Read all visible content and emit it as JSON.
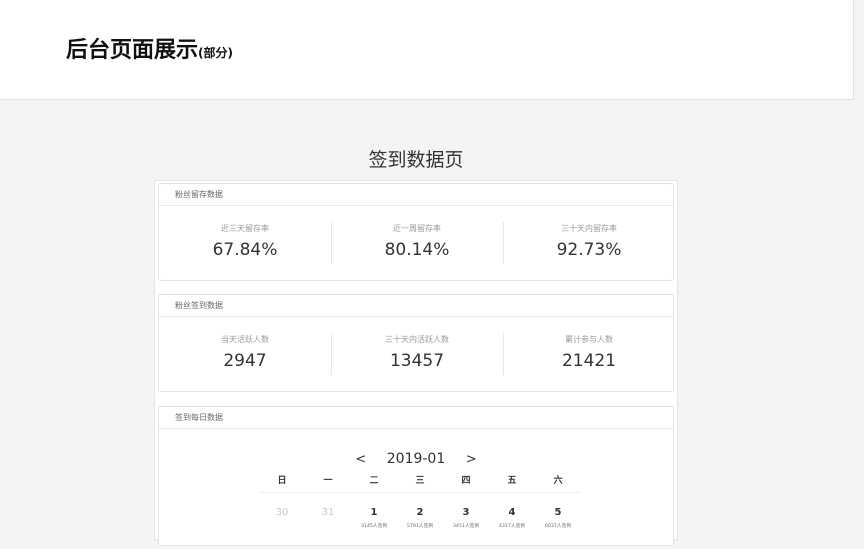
{
  "header": {
    "title": "后台页面展示",
    "subtitle": "(部分)"
  },
  "page_title": "签到数据页",
  "retention": {
    "title": "粉丝留存数据",
    "stats": [
      {
        "label": "近三天留存率",
        "value": "67.84%"
      },
      {
        "label": "近一周留存率",
        "value": "80.14%"
      },
      {
        "label": "三十天内留存率",
        "value": "92.73%"
      }
    ]
  },
  "signin": {
    "title": "粉丝签到数据",
    "stats": [
      {
        "label": "当天活跃人数",
        "value": "2947"
      },
      {
        "label": "三十天内活跃人数",
        "value": "13457"
      },
      {
        "label": "累计参与人数",
        "value": "21421"
      }
    ]
  },
  "daily": {
    "title": "签到每日数据",
    "month": "2019-01",
    "prev_label": "<",
    "next_label": ">",
    "weekdays": [
      "日",
      "一",
      "二",
      "三",
      "四",
      "五",
      "六"
    ],
    "days": [
      {
        "num": "30",
        "sign": ""
      },
      {
        "num": "31",
        "sign": ""
      },
      {
        "num": "1",
        "sign": "3145人签到"
      },
      {
        "num": "2",
        "sign": "5791人签到"
      },
      {
        "num": "3",
        "sign": "3451人签到"
      },
      {
        "num": "4",
        "sign": "4317人签到"
      },
      {
        "num": "5",
        "sign": "6037人签到"
      }
    ]
  }
}
